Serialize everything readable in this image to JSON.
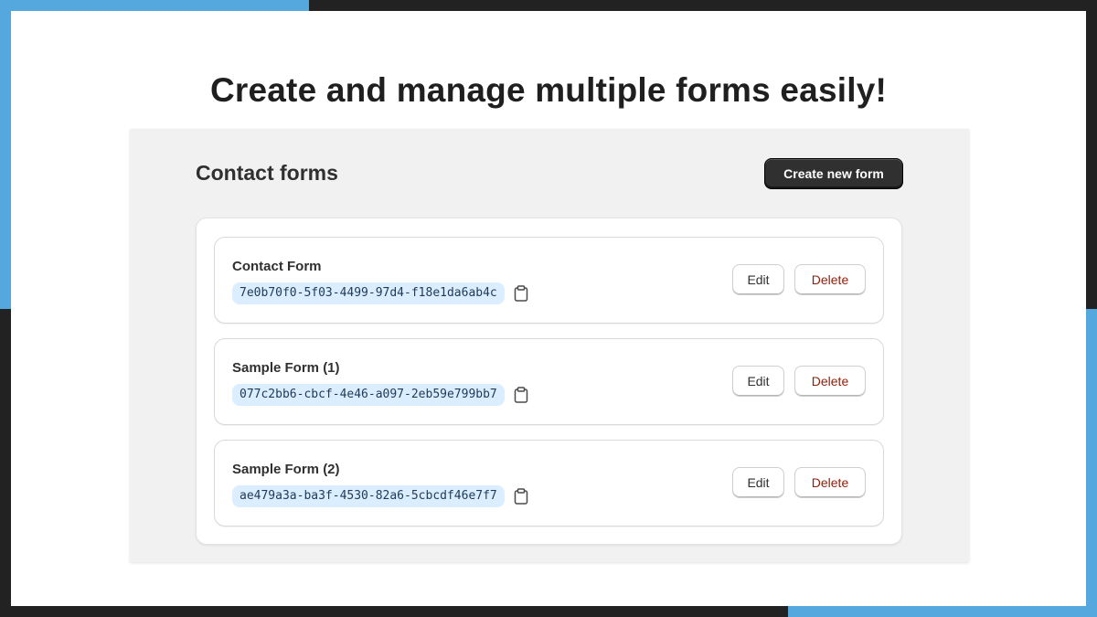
{
  "headline": "Create and manage multiple forms easily!",
  "app": {
    "title": "Contact forms",
    "create_label": "Create new form"
  },
  "forms": [
    {
      "name": "Contact Form",
      "id": "7e0b70f0-5f03-4499-97d4-f18e1da6ab4c",
      "edit_label": "Edit",
      "delete_label": "Delete"
    },
    {
      "name": "Sample Form (1)",
      "id": "077c2bb6-cbcf-4e46-a097-2eb59e799bb7",
      "edit_label": "Edit",
      "delete_label": "Delete"
    },
    {
      "name": "Sample Form (2)",
      "id": "ae479a3a-ba3f-4530-82a6-5cbcdf46e7f7",
      "edit_label": "Edit",
      "delete_label": "Delete"
    }
  ],
  "icons": {
    "copy": "clipboard-icon"
  },
  "colors": {
    "accent": "#55a8dd",
    "frame": "#222222",
    "id_badge": "#dbeeff",
    "primary_button": "#303030",
    "delete_text": "#8e1f0b"
  }
}
